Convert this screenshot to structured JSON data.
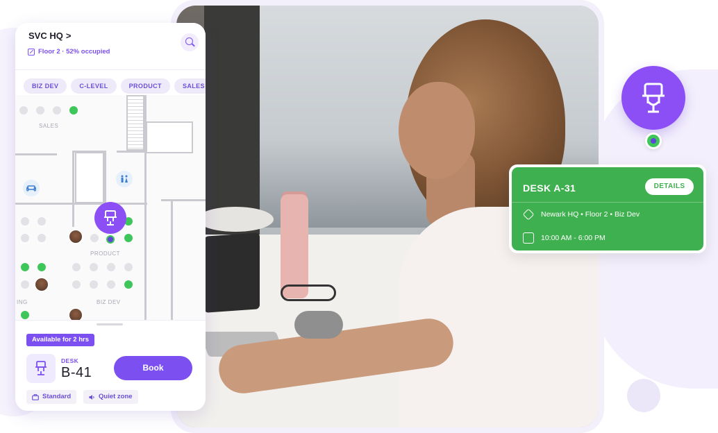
{
  "phone": {
    "location": "SVC HQ",
    "chevron": ">",
    "floor_status": "Floor 2 · 52% occupied",
    "chips": [
      "BIZ DEV",
      "C-LEVEL",
      "PRODUCT",
      "SALES"
    ],
    "map_labels": {
      "sales": "SALES",
      "product": "PRODUCT",
      "biz_dev": "BIZ DEV",
      "ing": "ING"
    },
    "bottom": {
      "availability": "Available for 2 hrs",
      "desk_label": "DESK",
      "desk_number": "B-41",
      "book_button": "Book",
      "tag_standard": "Standard",
      "tag_quiet": "Quiet zone"
    }
  },
  "desk_card": {
    "title": "DESK A-31",
    "details_button": "DETAILS",
    "location": "Newark HQ • Floor 2 • Biz Dev",
    "time": "10:00 AM - 6:00 PM",
    "color": "#3fb04f"
  },
  "colors": {
    "brand_purple": "#7b4ff0",
    "available_green": "#3fc65a"
  },
  "icons": [
    "search-icon",
    "floor-icon",
    "sofa-icon",
    "restroom-icon",
    "desk-chair-icon",
    "location-icon",
    "calendar-icon",
    "bag-icon",
    "speaker-icon"
  ]
}
